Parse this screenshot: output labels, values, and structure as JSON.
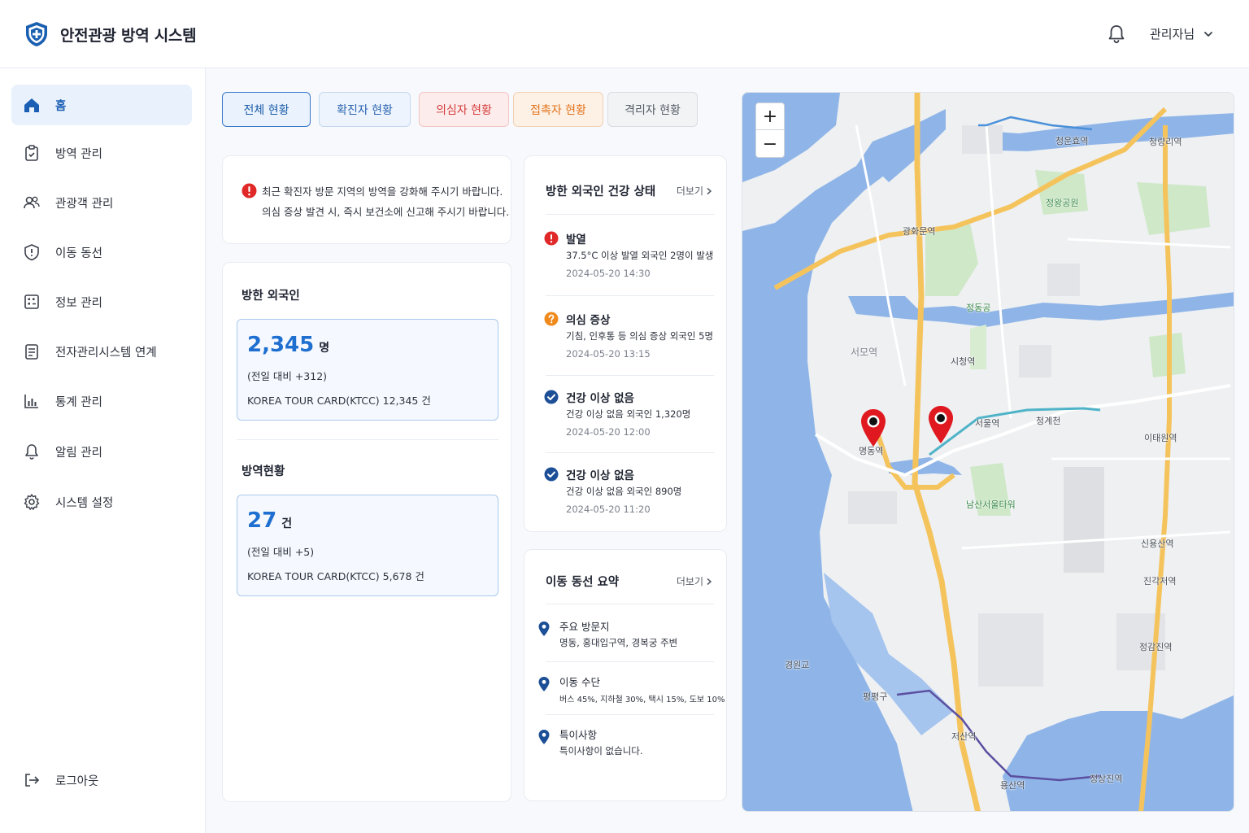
{
  "app": {
    "title": "안전관광 방역 시스템",
    "user": "관리자님"
  },
  "sidebar": {
    "items": [
      {
        "label": "홈",
        "icon": "home-icon"
      },
      {
        "label": "방역 관리",
        "icon": "clipboard-icon"
      },
      {
        "label": "관광객 관리",
        "icon": "users-icon"
      },
      {
        "label": "이동 동선",
        "icon": "route-icon"
      },
      {
        "label": "정보 관리",
        "icon": "info-board-icon"
      },
      {
        "label": "전자관리시스템 연계",
        "icon": "system-link-icon"
      },
      {
        "label": "통계 관리",
        "icon": "chart-icon"
      },
      {
        "label": "알림 관리",
        "icon": "bell-icon"
      },
      {
        "label": "시스템 설정",
        "icon": "gear-icon"
      }
    ],
    "logout": "로그아웃"
  },
  "tabs": [
    "전체 현황",
    "확진자 현황",
    "의심자 현황",
    "접촉자 현황",
    "격리자 현황"
  ],
  "notice": {
    "line1": "최근 확진자 방문 지역의 방역을 강화해 주시기 바랍니다.",
    "line2": "의심 증상 발견 시, 즉시 보건소에 신고해 주시기 바랍니다."
  },
  "stats": {
    "foreign": {
      "title": "방한 외국인",
      "value": "2,345",
      "unit": "명",
      "diff": "(전일 대비 +312)",
      "ktcc": "KOREA TOUR CARD(KTCC) 12,345 건"
    },
    "quarantine": {
      "title": "방역현황",
      "value": "27",
      "unit": "건",
      "diff": "(전일 대비 +5)",
      "ktcc": "KOREA TOUR CARD(KTCC) 5,678 건"
    }
  },
  "health": {
    "title": "방한 외국인 건강 상태",
    "more": "더보기",
    "items": [
      {
        "title": "발열",
        "desc": "37.5°C 이상 발열 외국인 2명이 발생",
        "time": "2024-05-20 14:30",
        "status": "alert"
      },
      {
        "title": "의심 증상",
        "desc": "기침, 인후통 등 의심 증상 외국인 5명",
        "time": "2024-05-20 13:15",
        "status": "question"
      },
      {
        "title": "건강 이상 없음",
        "desc": "건강 이상 없음 외국인 1,320명",
        "time": "2024-05-20 12:00",
        "status": "ok"
      },
      {
        "title": "건강 이상 없음",
        "desc": "건강 이상 없음 외국인 890명",
        "time": "2024-05-20 11:20",
        "status": "ok"
      }
    ]
  },
  "route": {
    "title": "이동 동선 요약",
    "more": "더보기",
    "items": [
      {
        "title": "주요 방문지",
        "desc": "명동, 홍대입구역, 경복궁 주변"
      },
      {
        "title": "이동 수단",
        "desc": "버스 45%, 지하철 30%, 택시 15%, 도보 10%"
      },
      {
        "title": "특이사항",
        "desc": "특이사항이 없습니다."
      }
    ]
  },
  "map": {
    "zoom_in": "+",
    "zoom_out": "−",
    "labels": [
      "광화문역",
      "청운효역",
      "정왕공원",
      "청량리역",
      "서울역",
      "명동역",
      "남산서울타워",
      "이태원역",
      "용산역",
      "서모역",
      "시청역",
      "청계천",
      "정동공",
      "신용산역",
      "저산역",
      "정상진역",
      "진각저역",
      "정감진역",
      "경원교",
      "평평구"
    ]
  },
  "colors": {
    "accent": "#1f6fd0",
    "danger": "#e02828",
    "warning": "#f08a1c",
    "brand": "#1a5fb4"
  }
}
